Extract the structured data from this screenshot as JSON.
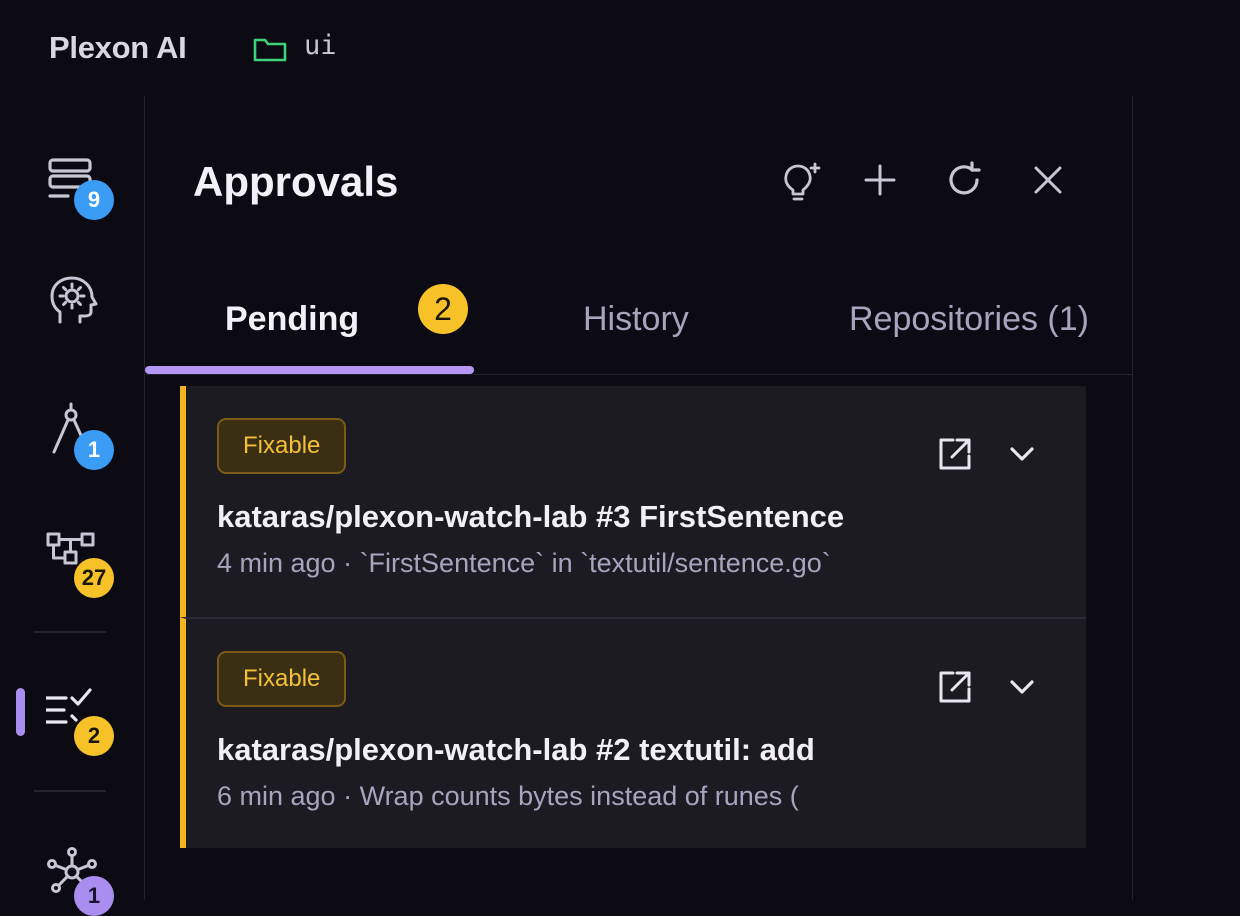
{
  "app": {
    "name": "Plexon AI",
    "workspace": "ui"
  },
  "rail": {
    "items": [
      {
        "icon": "stack-icon",
        "badge": "9",
        "badge_color": "#3b9cf5"
      },
      {
        "icon": "head-gear-icon"
      },
      {
        "icon": "compass-icon",
        "badge": "1",
        "badge_color": "#3b9cf5"
      },
      {
        "icon": "workflow-icon",
        "badge": "27",
        "badge_color": "#f7c228"
      },
      {
        "icon": "checklist-icon",
        "badge": "2",
        "badge_color": "#f7c228",
        "active": true
      },
      {
        "icon": "network-icon",
        "badge": "1",
        "badge_color": "#a98ef0"
      }
    ]
  },
  "panel": {
    "title": "Approvals",
    "header_actions": [
      "lightbulb-sparkle-icon",
      "plus-icon",
      "refresh-icon",
      "close-icon"
    ]
  },
  "tabs": [
    {
      "label": "Pending",
      "count": "2",
      "active": true
    },
    {
      "label": "History"
    },
    {
      "label": "Repositories (1)"
    }
  ],
  "approvals": [
    {
      "tag": "Fixable",
      "title": "kataras/plexon-watch-lab #3 FirstSentence",
      "subtitle": "4 min ago · `FirstSentence` in `textutil/sentence.go`"
    },
    {
      "tag": "Fixable",
      "title": "kataras/plexon-watch-lab #2 textutil: add",
      "subtitle": "6 min ago · Wrap counts bytes instead of runes ("
    }
  ],
  "colors": {
    "accent": "#b497f6",
    "warning": "#f2b51e",
    "info": "#3b9cf5",
    "background": "#0c0b13",
    "card": "#1c1b22"
  }
}
